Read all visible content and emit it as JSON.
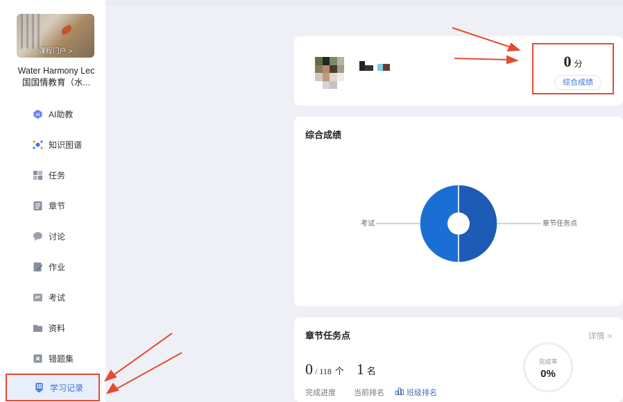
{
  "course": {
    "cover_label": "课程门户 >",
    "title_line1": "Water Harmony Lec",
    "title_line2": "国国情教育（水..."
  },
  "sidebar": {
    "items": [
      {
        "label": "AI助教",
        "icon": "ai-assistant-icon"
      },
      {
        "label": "知识图谱",
        "icon": "knowledge-graph-icon"
      },
      {
        "label": "任务",
        "icon": "task-grid-icon"
      },
      {
        "label": "章节",
        "icon": "chapter-icon"
      },
      {
        "label": "讨论",
        "icon": "discussion-icon"
      },
      {
        "label": "作业",
        "icon": "homework-icon"
      },
      {
        "label": "考试",
        "icon": "exam-icon"
      },
      {
        "label": "资料",
        "icon": "folder-icon"
      },
      {
        "label": "错题集",
        "icon": "wrong-questions-icon"
      },
      {
        "label": "学习记录",
        "icon": "study-record-icon",
        "active": true
      }
    ]
  },
  "profile": {
    "score_value": "0",
    "score_unit": "分",
    "score_button": "综合成绩"
  },
  "score_chart": {
    "title": "综合成绩",
    "chart_data": {
      "type": "pie",
      "categories": [
        "考试",
        "章节任务点"
      ],
      "values": [
        50,
        50
      ],
      "colors": [
        "#1b6fd4",
        "#1d5bb4"
      ]
    }
  },
  "tasks": {
    "title": "章节任务点",
    "detail_link": "详情 >",
    "done": "0",
    "total": "/ 118",
    "count_unit": "个",
    "rank": "1",
    "rank_unit": "名",
    "label_progress": "完成进度",
    "label_rank": "当前排名",
    "label_class_rank": "班级排名",
    "rate_label": "完成率",
    "rate_value": "0%"
  },
  "colors": {
    "accent": "#3a6fd8",
    "annotation_red": "#e34b32"
  }
}
